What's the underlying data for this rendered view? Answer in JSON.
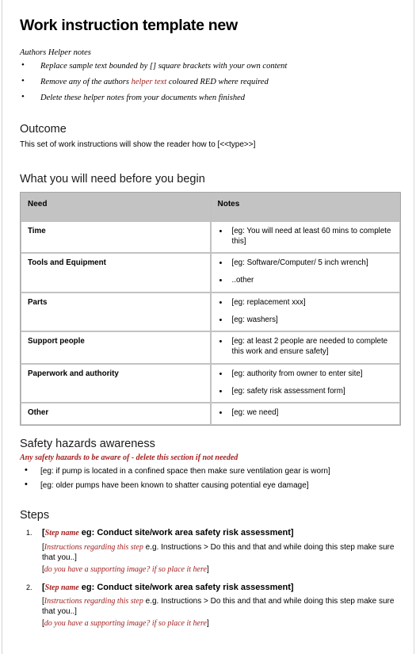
{
  "document": {
    "title": "Work instruction template new"
  },
  "authors_notes": {
    "label": "Authors Helper notes",
    "items": [
      {
        "text": "Replace sample text bounded by [] square brackets with your own content"
      },
      {
        "pre": "Remove any of the authors ",
        "red": "helper text",
        "post": " coloured RED where required"
      },
      {
        "text": "Delete these helper notes from your documents when finished"
      }
    ]
  },
  "outcome": {
    "heading": "Outcome",
    "text": "This set of work instructions will show the reader how to [<<type>>]"
  },
  "need_section": {
    "heading": "What you will need before you begin",
    "columns": [
      "Need",
      "Notes"
    ],
    "rows": [
      {
        "need": "Time",
        "notes": [
          "[eg: You will need at least 60 mins to complete this]"
        ]
      },
      {
        "need": "Tools and Equipment",
        "notes": [
          "[eg: Software/Computer/ 5 inch wrench]",
          "..other"
        ]
      },
      {
        "need": "Parts",
        "notes": [
          "[eg: replacement xxx]",
          "[eg: washers]"
        ]
      },
      {
        "need": "Support people",
        "notes": [
          "[eg: at least 2 people are needed to complete this work and ensure safety]"
        ]
      },
      {
        "need": "Paperwork and authority",
        "notes": [
          "[eg: authority from owner to enter site]",
          "[eg: safety risk assessment form]"
        ]
      },
      {
        "need": "Other",
        "notes": [
          "[eg: we need]"
        ]
      }
    ]
  },
  "safety_section": {
    "heading": "Safety hazards awareness",
    "note": "Any safety hazards to be aware of - delete this section if not needed",
    "items": [
      "[eg: if pump is located in a confined space then make sure ventilation gear is worn]",
      "[eg: older pumps have been known to shatter causing potential eye damage]"
    ]
  },
  "steps_section": {
    "heading": "Steps",
    "steps": [
      {
        "title_open": "[",
        "title_red": "Step name",
        "title_rest": " eg: Conduct site/work area safety risk assessment]",
        "instr_open": "[",
        "instr_red": "Instructions regarding this step",
        "instr_rest": " e.g. Instructions > Do this and that and while doing this step make sure that you..]",
        "image_open": "[",
        "image_red": "do you have a supporting image? if so place it here",
        "image_close": "]"
      },
      {
        "title_open": "[",
        "title_red": "Step name",
        "title_rest": " eg: Conduct site/work area safety risk assessment]",
        "instr_open": "[",
        "instr_red": "Instructions regarding this step",
        "instr_rest": " e.g. Instructions > Do this and that and while doing this step make sure that you..]",
        "image_open": "[",
        "image_red": "do you have a supporting image? if so place it here",
        "image_close": "]"
      }
    ]
  },
  "theme": {
    "red": "#A32020",
    "header_gray": "#C3C3C3",
    "border_gray": "#C2C2C2"
  }
}
